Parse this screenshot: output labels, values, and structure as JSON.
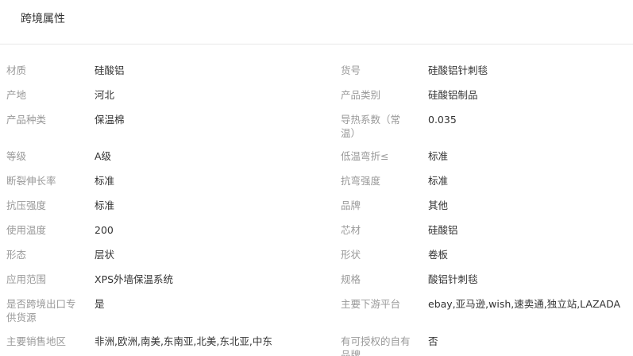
{
  "header": {
    "title": "跨境属性"
  },
  "rows": [
    {
      "left_label": "材质",
      "left_value": "硅酸铝",
      "right_label": "货号",
      "right_value": "硅酸铝针刺毯"
    },
    {
      "left_label": "产地",
      "left_value": "河北",
      "right_label": "产品类别",
      "right_value": "硅酸铝制品"
    },
    {
      "left_label": "产品种类",
      "left_value": "保温棉",
      "right_label": "导热系数（常温）",
      "right_value": "0.035"
    },
    {
      "left_label": "等级",
      "left_value": "A级",
      "right_label": "低温弯折≤",
      "right_value": "标准"
    },
    {
      "left_label": "断裂伸长率",
      "left_value": "标准",
      "right_label": "抗弯强度",
      "right_value": "标准"
    },
    {
      "left_label": "抗压强度",
      "left_value": "标准",
      "right_label": "品牌",
      "right_value": "其他"
    },
    {
      "left_label": "使用温度",
      "left_value": "200",
      "right_label": "芯材",
      "right_value": "硅酸铝"
    },
    {
      "left_label": "形态",
      "left_value": "层状",
      "right_label": "形状",
      "right_value": "卷板"
    },
    {
      "left_label": "应用范围",
      "left_value": "XPS外墙保温系统",
      "right_label": "规格",
      "right_value": "酸铝针刺毯"
    },
    {
      "left_label": "是否跨境出口专供货源",
      "left_value": "是",
      "right_label": "主要下游平台",
      "right_value": "ebay,亚马逊,wish,速卖通,独立站,LAZADA"
    },
    {
      "left_label": "主要销售地区",
      "left_value": "非洲,欧洲,南美,东南亚,北美,东北亚,中东",
      "right_label": "有可授权的自有品牌",
      "right_value": "否"
    }
  ]
}
